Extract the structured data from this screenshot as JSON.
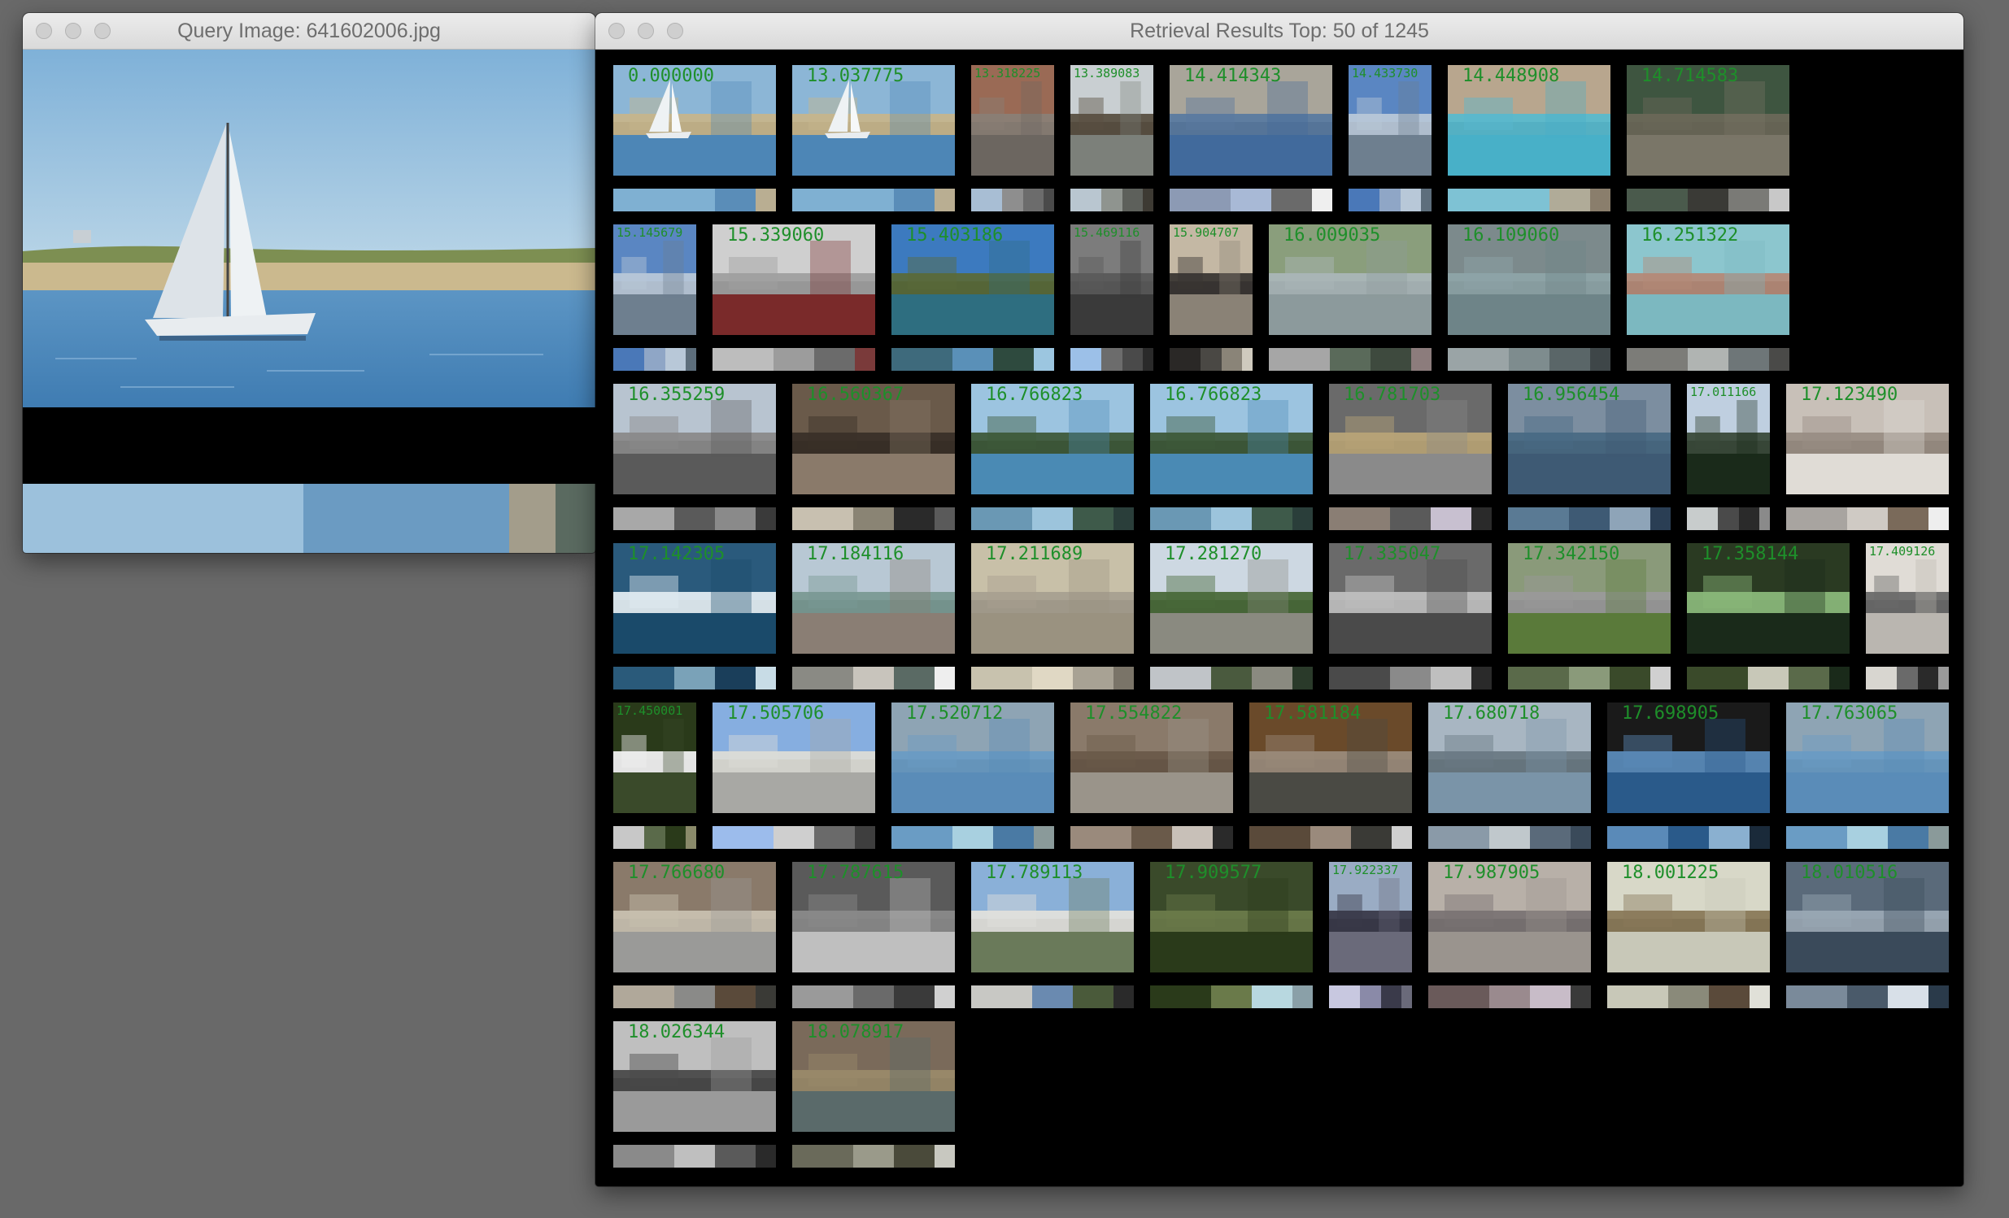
{
  "query_window": {
    "title": "Query Image: 641602006.jpg",
    "image_icon": "sailboat-photo",
    "palette": [
      {
        "color": "#9cc1dc",
        "weight": 49
      },
      {
        "color": "#6b9bc2",
        "weight": 36
      },
      {
        "color": "#a39d8b",
        "weight": 8
      },
      {
        "color": "#5a6a60",
        "weight": 7
      }
    ]
  },
  "results_window": {
    "title": "Retrieval Results Top: 50 of 1245",
    "rows": [
      [
        {
          "score": "0.000000",
          "w": "wide",
          "sky": "#8cb6d6",
          "mid": "#c6b58c",
          "low": "#4d86b6",
          "fg": "sailboat",
          "pal": [
            "#7fb0d2",
            "#7fb0d2",
            "#5a8db8",
            "#b9ae92"
          ]
        },
        {
          "score": "13.037775",
          "w": "wide",
          "sky": "#8cb6d6",
          "mid": "#c6b58c",
          "low": "#4d86b6",
          "fg": "sailboat",
          "pal": [
            "#7fb0d2",
            "#7fb0d2",
            "#5a8db8",
            "#b9ae92"
          ]
        },
        {
          "score": "13.318225",
          "w": "narrow",
          "sky": "#9a6a55",
          "mid": "#8a7f76",
          "low": "#6c6660",
          "fg": "",
          "pal": [
            "#a8bed4",
            "#8e8e8e",
            "#6c6c6c",
            "#4a4a4a"
          ]
        },
        {
          "score": "13.389083",
          "w": "narrow",
          "sky": "#c9cfd2",
          "mid": "#5a5042",
          "low": "#7c807a",
          "fg": "",
          "pal": [
            "#b9c6d0",
            "#8f948f",
            "#5d605b",
            "#3d3a33"
          ]
        },
        {
          "score": "14.414343",
          "w": "wide",
          "sky": "#a9a59a",
          "mid": "#5a7aa0",
          "low": "#416a9c",
          "fg": "",
          "pal": [
            "#8c9ab4",
            "#a8b9d6",
            "#6a6a6a",
            "#efefef"
          ]
        },
        {
          "score": "14.433730",
          "w": "narrow",
          "sky": "#5a86c2",
          "mid": "#b8c7d8",
          "low": "#6e7f8f",
          "fg": "",
          "pal": [
            "#4a78b8",
            "#8fa6c6",
            "#b8c8d8",
            "#5d6e7c"
          ]
        },
        {
          "score": "14.448908",
          "w": "wide",
          "sky": "#b8a68e",
          "mid": "#58b9ce",
          "low": "#48b0c8",
          "fg": "",
          "pal": [
            "#7ec2d4",
            "#7ec2d4",
            "#b0ab98",
            "#8a7e6c"
          ]
        },
        {
          "score": "14.714583",
          "w": "wide",
          "sky": "#3e5540",
          "mid": "#6a6858",
          "low": "#7a7668",
          "fg": "",
          "pal": [
            "#4a5a4c",
            "#3a3a36",
            "#7a7a76",
            "#c8c8c8"
          ]
        }
      ],
      [
        {
          "score": "15.145679",
          "w": "narrow",
          "sky": "#5a86c2",
          "mid": "#b8c7d8",
          "low": "#6e7f8f",
          "fg": "",
          "pal": [
            "#4a78b8",
            "#8fa6c6",
            "#b8c8d8",
            "#5d6e7c"
          ]
        },
        {
          "score": "15.339060",
          "w": "wide",
          "sky": "#cfcfcf",
          "mid": "#9f9f9f",
          "low": "#7a2a2a",
          "fg": "",
          "pal": [
            "#bdbdbd",
            "#9c9c9c",
            "#6b6b6b",
            "#7a3a3a"
          ]
        },
        {
          "score": "15.403186",
          "w": "wide",
          "sky": "#3c7abf",
          "mid": "#5a6a3a",
          "low": "#2e6e80",
          "fg": "",
          "pal": [
            "#3e6a7c",
            "#5a90b8",
            "#2e4a3e",
            "#9cc6e0"
          ]
        },
        {
          "score": "15.469116",
          "w": "narrow",
          "sky": "#7c7c7c",
          "mid": "#5a5a5a",
          "low": "#3a3a3a",
          "fg": "",
          "pal": [
            "#9cc0e8",
            "#6c6c6c",
            "#4a4a4a",
            "#2a2a2a"
          ]
        },
        {
          "score": "15.904707",
          "w": "narrow",
          "sky": "#c4b8a4",
          "mid": "#3a3634",
          "low": "#8a8276",
          "fg": "",
          "pal": [
            "#2a2826",
            "#4a4844",
            "#8a8478",
            "#cfcabe"
          ]
        },
        {
          "score": "16.009035",
          "w": "wide",
          "sky": "#8a9e7c",
          "mid": "#aab6b8",
          "low": "#8c9a9c",
          "fg": "",
          "pal": [
            "#a6a6a6",
            "#5a6a5a",
            "#3e4a3e",
            "#8c7c7c"
          ]
        },
        {
          "score": "16.109060",
          "w": "wide",
          "sky": "#7c8a8c",
          "mid": "#8ea4a8",
          "low": "#6e8488",
          "fg": "",
          "pal": [
            "#9aa4a6",
            "#7e8c8e",
            "#5a6668",
            "#3e4648"
          ]
        },
        {
          "score": "16.251322",
          "w": "wide",
          "sky": "#8cc6ce",
          "mid": "#b48a78",
          "low": "#7cb8c0",
          "fg": "",
          "pal": [
            "#7c7c78",
            "#b0b4b2",
            "#6e7678",
            "#4a4a48"
          ]
        }
      ],
      [
        {
          "score": "16.355259",
          "w": "wide",
          "sky": "#b8c4d0",
          "mid": "#8a8a8a",
          "low": "#5a5a5a",
          "fg": "",
          "pal": [
            "#a8a8a8",
            "#5a5a5a",
            "#8a8a8a",
            "#3a3a3a"
          ]
        },
        {
          "score": "16.560367",
          "w": "wide",
          "sky": "#6a5a4a",
          "mid": "#3a3028",
          "low": "#8a7a6a",
          "fg": "",
          "pal": [
            "#c8c0b0",
            "#8a8474",
            "#2a2a2a",
            "#5a5a5a"
          ]
        },
        {
          "score": "16.766823",
          "w": "wide",
          "sky": "#9cc4e0",
          "mid": "#3e5a3a",
          "low": "#4a8ab4",
          "fg": "",
          "pal": [
            "#6a98b4",
            "#9cc4dc",
            "#3e5a4a",
            "#2a3e3a"
          ]
        },
        {
          "score": "16.766823",
          "w": "wide",
          "sky": "#9cc4e0",
          "mid": "#3e5a3a",
          "low": "#4a8ab4",
          "fg": "",
          "pal": [
            "#6a98b4",
            "#9cc4dc",
            "#3e5a4a",
            "#2a3e3a"
          ]
        },
        {
          "score": "16.781703",
          "w": "wide",
          "sky": "#6a6a6a",
          "mid": "#b8a478",
          "low": "#8a8a8a",
          "fg": "",
          "pal": [
            "#8a7e74",
            "#5a5a5a",
            "#c8c0d0",
            "#2a2a2a"
          ]
        },
        {
          "score": "16.956454",
          "w": "wide",
          "sky": "#7c8ea0",
          "mid": "#4a6a84",
          "low": "#3e5a74",
          "fg": "",
          "pal": [
            "#5a7a94",
            "#3e5a74",
            "#8ea4b8",
            "#2a3e54"
          ]
        },
        {
          "score": "17.011166",
          "w": "narrow",
          "sky": "#bfcfe0",
          "mid": "#3a4a3a",
          "low": "#1a2a1a",
          "fg": "",
          "pal": [
            "#c8cccc",
            "#4a4a4a",
            "#2a2a2a",
            "#8a8a8a"
          ]
        },
        {
          "score": "17.123490",
          "w": "wide",
          "sky": "#c8c0b8",
          "mid": "#9a8e84",
          "low": "#e0dcd6",
          "fg": "",
          "pal": [
            "#a8a4a0",
            "#cfcac4",
            "#7a6a5a",
            "#eeeeee"
          ]
        }
      ],
      [
        {
          "score": "17.142305",
          "w": "wide",
          "sky": "#2a5a7c",
          "mid": "#e0ecf2",
          "low": "#1a4a6a",
          "fg": "",
          "pal": [
            "#2a5a7a",
            "#7aa2b8",
            "#1a3e5a",
            "#c8dce6"
          ]
        },
        {
          "score": "17.184116",
          "w": "wide",
          "sky": "#b8c8d4",
          "mid": "#7a9a94",
          "low": "#8a7e74",
          "fg": "",
          "pal": [
            "#8a8a84",
            "#c8c4bc",
            "#5a6a64",
            "#eeeeee"
          ]
        },
        {
          "score": "17.211689",
          "w": "wide",
          "sky": "#c8c0a8",
          "mid": "#a8a090",
          "low": "#9a9280",
          "fg": "",
          "pal": [
            "#c8c2ae",
            "#e0d8c4",
            "#a8a294",
            "#7a7468"
          ]
        },
        {
          "score": "17.281270",
          "w": "wide",
          "sky": "#cdd8e2",
          "mid": "#4a6a3a",
          "low": "#8a8a80",
          "fg": "",
          "pal": [
            "#c0c4c8",
            "#4a5a3e",
            "#8a8a80",
            "#2a3a2a"
          ]
        },
        {
          "score": "17.335047",
          "w": "wide",
          "sky": "#6a6a6a",
          "mid": "#bfbfbf",
          "low": "#4a4a4a",
          "fg": "",
          "pal": [
            "#4a4a4a",
            "#8a8a8a",
            "#bfbfbf",
            "#2a2a2a"
          ]
        },
        {
          "score": "17.342150",
          "w": "wide",
          "sky": "#8a9a7a",
          "mid": "#9a9a9a",
          "low": "#5a7a3a",
          "fg": "",
          "pal": [
            "#5a6a4a",
            "#8a9a7a",
            "#3a4a2a",
            "#d0d0d0"
          ]
        },
        {
          "score": "17.358144",
          "w": "wide",
          "sky": "#2a3a22",
          "mid": "#8ab87a",
          "low": "#1a2a1a",
          "fg": "",
          "pal": [
            "#3a4a2a",
            "#c8c8b8",
            "#5a6a4a",
            "#1a2a1a"
          ]
        },
        {
          "score": "17.409126",
          "w": "narrow",
          "sky": "#e0dcd6",
          "mid": "#6a6a6a",
          "low": "#bab6b0",
          "fg": "",
          "pal": [
            "#d8d6d0",
            "#6a6a6a",
            "#2a2a2a",
            "#9a9a9a"
          ]
        }
      ],
      [
        {
          "score": "17.450001",
          "w": "narrow",
          "sky": "#2a3a1a",
          "mid": "#f0f0f0",
          "low": "#3a4a2a",
          "fg": "",
          "pal": [
            "#c8c8c8",
            "#5a6a4a",
            "#2a3a1a",
            "#8a8a6a"
          ]
        },
        {
          "score": "17.505706",
          "w": "wide",
          "sky": "#86aee0",
          "mid": "#dcdcd6",
          "low": "#a8a8a4",
          "fg": "",
          "pal": [
            "#9cbcec",
            "#cfcfcf",
            "#6a6a6a",
            "#3e3e3e"
          ]
        },
        {
          "score": "17.520712",
          "w": "wide",
          "sky": "#8ea4b4",
          "mid": "#6a9cc4",
          "low": "#5a8cb8",
          "fg": "",
          "pal": [
            "#6a9cc4",
            "#a8d0e0",
            "#4a7aa4",
            "#8a9a9a"
          ]
        },
        {
          "score": "17.554822",
          "w": "wide",
          "sky": "#8a7a6a",
          "mid": "#6a5a4a",
          "low": "#9a948a",
          "fg": "",
          "pal": [
            "#9a8a7c",
            "#6a5a4a",
            "#c8c0b8",
            "#2a2a2a"
          ]
        },
        {
          "score": "17.581184",
          "w": "wide",
          "sky": "#6a4a2a",
          "mid": "#9a8a7a",
          "low": "#4a4a44",
          "fg": "",
          "pal": [
            "#5a4a3a",
            "#9a8a7c",
            "#3a3a36",
            "#cfcfcf"
          ]
        },
        {
          "score": "17.680718",
          "w": "wide",
          "sky": "#a8b6c2",
          "mid": "#6a7a84",
          "low": "#7a94a8",
          "fg": "",
          "pal": [
            "#8a9aa8",
            "#c0c8cc",
            "#5a6a7a",
            "#3a4a5a"
          ]
        },
        {
          "score": "17.698905",
          "w": "wide",
          "sky": "#1a1a1a",
          "mid": "#5a8ab8",
          "low": "#2a5a8a",
          "fg": "",
          "pal": [
            "#5a8ab8",
            "#2a5a8a",
            "#8ab0d0",
            "#1a2a3a"
          ]
        },
        {
          "score": "17.763065",
          "w": "wide",
          "sky": "#8ea4b4",
          "mid": "#6a9cc4",
          "low": "#5a8cb8",
          "fg": "",
          "pal": [
            "#6a9cc4",
            "#a8d0e0",
            "#4a7aa4",
            "#8a9a9a"
          ]
        }
      ],
      [
        {
          "score": "17.766680",
          "w": "wide",
          "sky": "#8a7a6a",
          "mid": "#c8c0b0",
          "low": "#9a9a98",
          "fg": "",
          "pal": [
            "#b0a89a",
            "#8a8a88",
            "#5a4a3a",
            "#3a3a36"
          ]
        },
        {
          "score": "17.787615",
          "w": "wide",
          "sky": "#5a5a5a",
          "mid": "#8a8a8a",
          "low": "#bfbfbf",
          "fg": "",
          "pal": [
            "#9a9a9a",
            "#6a6a6a",
            "#3a3a3a",
            "#d0d0d0"
          ]
        },
        {
          "score": "17.789113",
          "w": "wide",
          "sky": "#8ab0d8",
          "mid": "#e0e0dc",
          "low": "#6a7a5a",
          "fg": "",
          "pal": [
            "#c8c8c4",
            "#6a8ab0",
            "#4a5a3a",
            "#2a2a2a"
          ]
        },
        {
          "score": "17.909577",
          "w": "wide",
          "sky": "#3a4a2a",
          "mid": "#6a7a4a",
          "low": "#2a3a1a",
          "fg": "",
          "pal": [
            "#2a3a1a",
            "#6a7a4a",
            "#b8d8e0",
            "#8aa0a8"
          ]
        },
        {
          "score": "17.922337",
          "w": "narrow",
          "sky": "#9aacc4",
          "mid": "#3a3a4a",
          "low": "#6a6a7a",
          "fg": "",
          "pal": [
            "#c8c8e0",
            "#8a8aa8",
            "#3a3a4a",
            "#6a6a7a"
          ]
        },
        {
          "score": "17.987905",
          "w": "wide",
          "sky": "#b8b0a8",
          "mid": "#7a7474",
          "low": "#9a948e",
          "fg": "",
          "pal": [
            "#6a5a5a",
            "#9a8a8e",
            "#c8bcc8",
            "#3a3a3a"
          ]
        },
        {
          "score": "18.001225",
          "w": "wide",
          "sky": "#d8d8c8",
          "mid": "#8a7a5a",
          "low": "#c8c8b8",
          "fg": "",
          "pal": [
            "#c8c8b8",
            "#8a8a7a",
            "#5a4a3a",
            "#e0e0d8"
          ]
        },
        {
          "score": "18.010516",
          "w": "wide",
          "sky": "#5a6a7a",
          "mid": "#9aa8b4",
          "low": "#3a4a5a",
          "fg": "",
          "pal": [
            "#7a8a9a",
            "#4a5a6a",
            "#d8e0e8",
            "#2a3a4a"
          ]
        }
      ],
      [
        {
          "score": "18.026344",
          "w": "wide",
          "sky": "#bfbfbf",
          "mid": "#4a4a4a",
          "low": "#9a9a9a",
          "fg": "",
          "pal": [
            "#8a8a8a",
            "#bfbfbf",
            "#5a5a5a",
            "#2a2a2a"
          ]
        },
        {
          "score": "18.078917",
          "w": "wide",
          "sky": "#7a6a5a",
          "mid": "#9a8a6a",
          "low": "#5a6a6a",
          "fg": "",
          "pal": [
            "#6a6a5a",
            "#9a9a8a",
            "#4a4a3a",
            "#c8c8c0"
          ]
        }
      ]
    ]
  }
}
